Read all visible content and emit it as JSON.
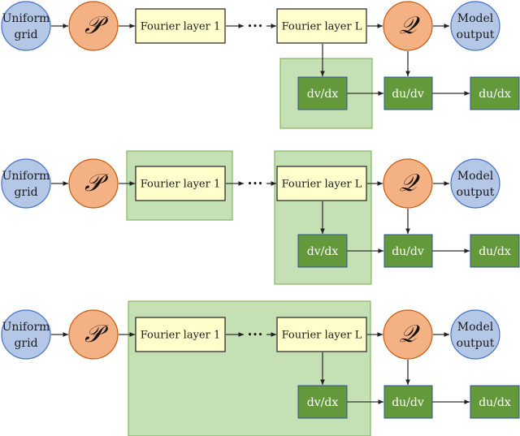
{
  "colors": {
    "input_circle": "#b4c7e7",
    "input_circle_stroke": "#4472c4",
    "proj_circle": "#f4b183",
    "proj_circle_stroke": "#c55a11",
    "fourier_box": "#ffffcc",
    "deriv_box": "#63983b",
    "deriv_box_stroke": "#2f5597",
    "highlight": "#c5e0b4",
    "highlight_stroke": "#70ad47"
  },
  "labels": {
    "input_line1": "Uniform",
    "input_line2": "grid",
    "lift": "𝒫",
    "fourier_first": "Fourier layer 1",
    "ellipsis": "•••",
    "fourier_last": "Fourier layer L",
    "proj": "𝒬",
    "output_line1": "Model",
    "output_line2": "output",
    "dvdx": "dv/dx",
    "dudv": "du/dv",
    "dudx": "du/dx"
  },
  "rows": [
    {
      "name": "row-1",
      "highlight": "dvdx-only"
    },
    {
      "name": "row-2",
      "highlight": "fourier1-and-fourierL-dvdx"
    },
    {
      "name": "row-3",
      "highlight": "fourier1-through-dvdx"
    }
  ]
}
